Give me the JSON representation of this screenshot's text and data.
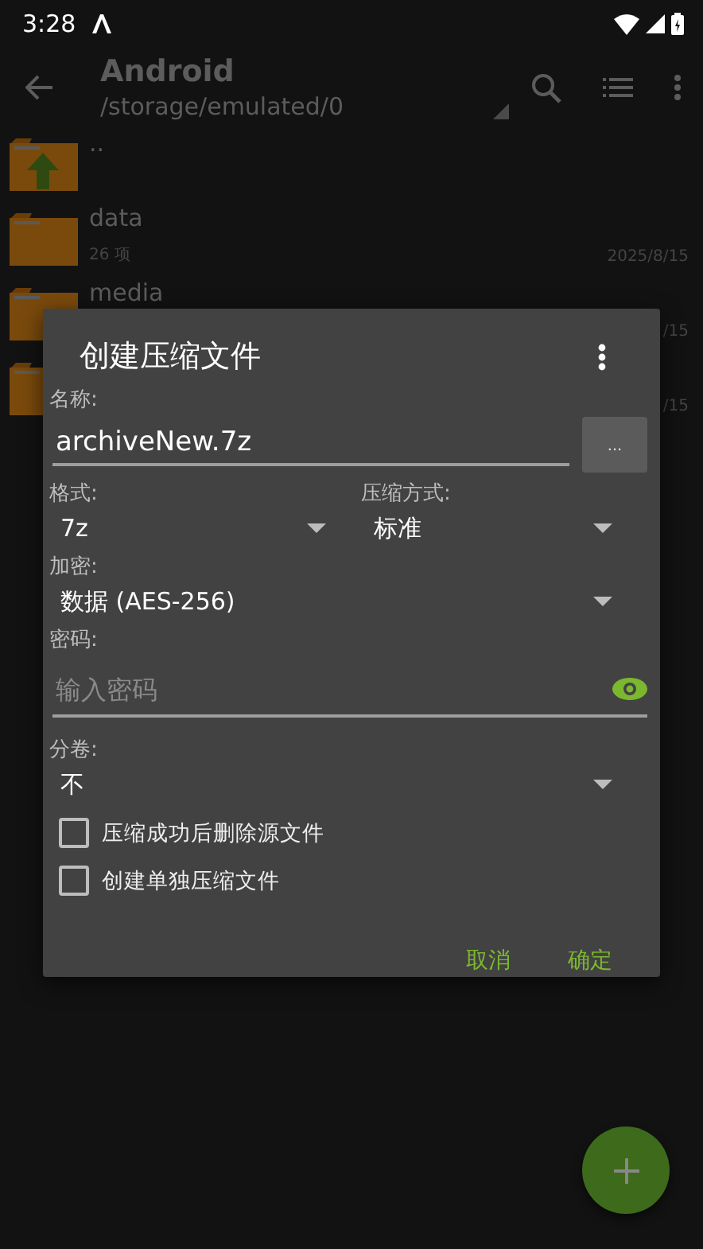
{
  "status_bar": {
    "time": "3:28"
  },
  "toolbar": {
    "title": "Android",
    "path": "/storage/emulated/0"
  },
  "files": [
    {
      "kind": "parent",
      "name": ".."
    },
    {
      "kind": "folder",
      "name": "data",
      "meta": "26 项",
      "date": "2025/8/15"
    },
    {
      "kind": "folder",
      "name": "media",
      "date": "/15"
    },
    {
      "kind": "folder",
      "date": "/15"
    }
  ],
  "dialog": {
    "title": "创建压缩文件",
    "name_label": "名称:",
    "name_value": "archiveNew.7z",
    "browse_button": "...",
    "format": {
      "label": "格式:",
      "value": "7z"
    },
    "method": {
      "label": "压缩方式:",
      "value": "标准"
    },
    "encryption": {
      "label": "加密:",
      "value": "数据 (AES-256)"
    },
    "password": {
      "label": "密码:",
      "placeholder": "输入密码"
    },
    "split": {
      "label": "分卷:",
      "value": "不"
    },
    "options": [
      {
        "label": "压缩成功后删除源文件",
        "checked": false
      },
      {
        "label": "创建单独压缩文件",
        "checked": false
      }
    ],
    "buttons": [
      "取消",
      "确定"
    ]
  }
}
